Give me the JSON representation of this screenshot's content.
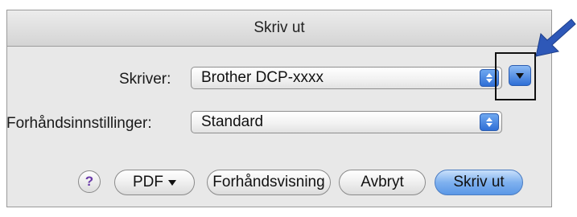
{
  "dialog": {
    "title": "Skriv ut"
  },
  "printer": {
    "label": "Skriver:",
    "value": "Brother DCP-xxxx"
  },
  "presets": {
    "label": "Forhåndsinnstillinger:",
    "value": "Standard"
  },
  "buttons": {
    "help": "?",
    "pdf": "PDF",
    "preview": "Forhåndsvisning",
    "cancel": "Avbryt",
    "print": "Skriv ut"
  },
  "colors": {
    "accent_blue": "#2f6fd6",
    "annotation_arrow": "#2e58b8",
    "highlight_box": "#111111"
  },
  "icons": {
    "disclosure": "chevron-down-icon",
    "stepper": "up-down-stepper-icon",
    "help": "question-mark-icon",
    "annotation": "arrow-pointer-icon"
  }
}
